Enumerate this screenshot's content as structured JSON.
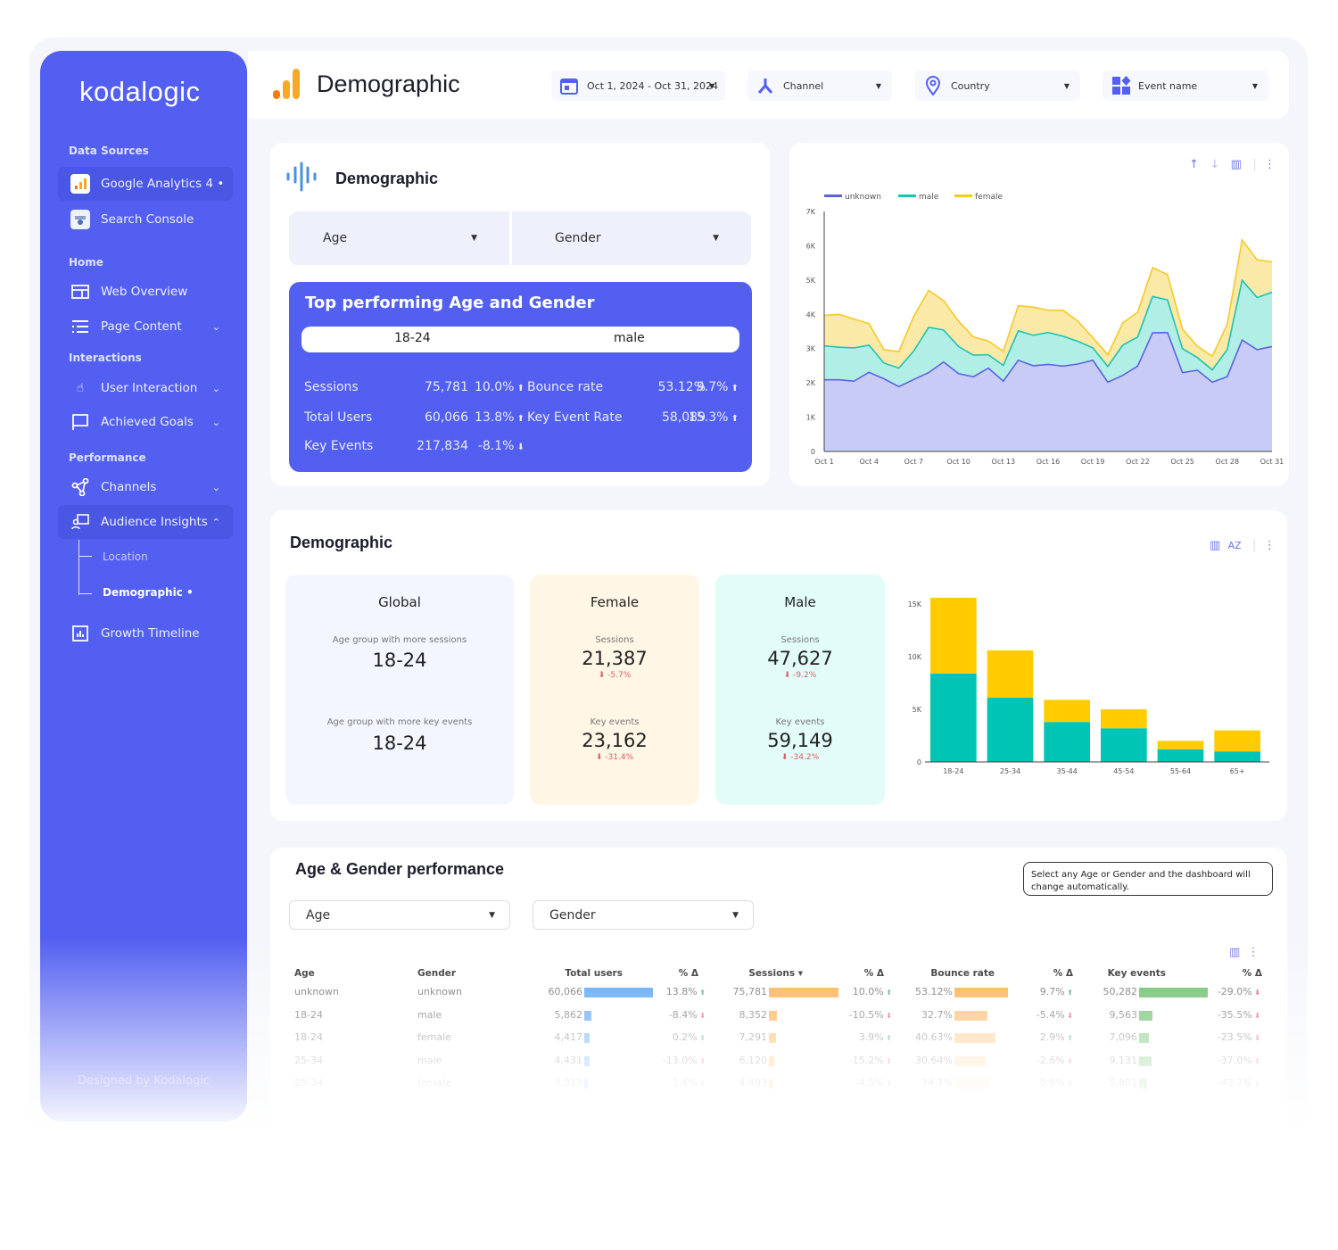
{
  "sidebar": {
    "logo": "kodalogic",
    "sections": {
      "data_sources": "Data Sources",
      "home": "Home",
      "interactions": "Interactions",
      "performance": "Performance"
    },
    "items": [
      {
        "label": "Google Analytics 4 •",
        "icon": "google-analytics-icon"
      },
      {
        "label": "Search Console",
        "icon": "search-console-icon"
      },
      {
        "label": "Web Overview",
        "icon": "web-overview-icon"
      },
      {
        "label": "Page Content",
        "icon": "list-icon"
      },
      {
        "label": "User Interaction",
        "icon": "hand-pointer-icon"
      },
      {
        "label": "Achieved Goals",
        "icon": "flag-icon"
      },
      {
        "label": "Channels",
        "icon": "share-nodes-icon"
      },
      {
        "label": "Audience Insights",
        "icon": "audience-icon"
      },
      {
        "label": "Growth Timeline",
        "icon": "bar-chart-icon"
      }
    ],
    "subitems": [
      {
        "label": "Location"
      },
      {
        "label": "Demographic •"
      }
    ],
    "footer": "Designed by Kodalogic"
  },
  "header": {
    "title": "Demographic",
    "filters": [
      {
        "label": "Oct 1, 2024 - Oct 31, 2024",
        "icon": "calendar-icon"
      },
      {
        "label": "Channel",
        "icon": "channel-icon"
      },
      {
        "label": "Country",
        "icon": "location-pin-icon"
      },
      {
        "label": "Event name",
        "icon": "shapes-icon"
      }
    ]
  },
  "colors": {
    "accent": "#525ff0",
    "unknown": "#5b62e0",
    "male": "#1fc2b0",
    "female": "#f5c928",
    "bar_male": "#00c4b4",
    "bar_female": "#ffcc00"
  },
  "top_card": {
    "title": "Demographic",
    "age_select": "Age",
    "gender_select": "Gender",
    "top": {
      "title": "Top performing Age and Gender",
      "age": "18-24",
      "gender": "male",
      "metrics": [
        {
          "label": "Sessions",
          "value": "75,781",
          "delta": "10.0%",
          "dir": "up"
        },
        {
          "label": "Bounce rate",
          "value": "53.12%",
          "delta": "9.7%",
          "dir": "up"
        },
        {
          "label": "Total Users",
          "value": "60,066",
          "delta": "13.8%",
          "dir": "up"
        },
        {
          "label": "Key Event Rate",
          "value": "58,089",
          "delta": "15.3%",
          "dir": "up"
        },
        {
          "label": "Key Events",
          "value": "217,834",
          "delta": "-8.1%",
          "dir": "down"
        }
      ]
    }
  },
  "demo": {
    "title": "Demographic",
    "global": {
      "title": "Global",
      "l1": "Age group with more sessions",
      "v1": "18-24",
      "l2": "Age group with more key events",
      "v2": "18-24"
    },
    "female": {
      "title": "Female",
      "l1": "Sessions",
      "v1": "21,387",
      "d1": "-5.7%",
      "l2": "Key events",
      "v2": "23,162",
      "d2": "-31.4%"
    },
    "male": {
      "title": "Male",
      "l1": "Sessions",
      "v1": "47,627",
      "d1": "-9.2%",
      "l2": "Key events",
      "v2": "59,149",
      "d2": "-34.2%"
    }
  },
  "table": {
    "title": "Age & Gender performance",
    "age_select": "Age",
    "gender_select": "Gender",
    "note": "Select any Age or Gender and the dashboard will change automatically.",
    "headers": [
      "Age",
      "Gender",
      "Total users",
      "% Δ",
      "Sessions ▾",
      "% Δ",
      "Bounce rate",
      "% Δ",
      "Key events",
      "% Δ"
    ],
    "rows": [
      {
        "age": "unknown",
        "gender": "unknown",
        "users": "60,066",
        "users_n": 60066,
        "ud": "13.8%",
        "udir": "up",
        "sessions": "75,781",
        "sessions_n": 75781,
        "sd": "10.0%",
        "sdir": "up",
        "bounce": "53.12%",
        "bounce_n": 53.12,
        "bd": "9.7%",
        "bdir": "up",
        "key": "50,282",
        "key_n": 50282,
        "kd": "-29.0%",
        "kdir": "down"
      },
      {
        "age": "18-24",
        "gender": "male",
        "users": "5,862",
        "users_n": 5862,
        "ud": "-8.4%",
        "udir": "down",
        "sessions": "8,352",
        "sessions_n": 8352,
        "sd": "-10.5%",
        "sdir": "down",
        "bounce": "32.7%",
        "bounce_n": 32.7,
        "bd": "-5.4%",
        "bdir": "down",
        "key": "9,563",
        "key_n": 9563,
        "kd": "-35.5%",
        "kdir": "down"
      },
      {
        "age": "18-24",
        "gender": "female",
        "users": "4,417",
        "users_n": 4417,
        "ud": "0.2%",
        "udir": "up",
        "sessions": "7,291",
        "sessions_n": 7291,
        "sd": "3.9%",
        "sdir": "up",
        "bounce": "40.63%",
        "bounce_n": 40.63,
        "bd": "2.9%",
        "bdir": "up",
        "key": "7,096",
        "key_n": 7096,
        "kd": "-23.5%",
        "kdir": "down"
      },
      {
        "age": "25-34",
        "gender": "male",
        "users": "4,431",
        "users_n": 4431,
        "ud": "-13.0%",
        "udir": "down",
        "sessions": "6,120",
        "sessions_n": 6120,
        "sd": "-15.2%",
        "sdir": "down",
        "bounce": "30.64%",
        "bounce_n": 30.64,
        "bd": "-2.6%",
        "bdir": "down",
        "key": "9,131",
        "key_n": 9131,
        "kd": "-37.0%",
        "kdir": "down"
      },
      {
        "age": "25-34",
        "gender": "female",
        "users": "3,013",
        "users_n": 3013,
        "ud": "1.4%",
        "udir": "up",
        "sessions": "4,493",
        "sessions_n": 4493,
        "sd": "-4.5%",
        "sdir": "down",
        "bounce": "34.7%",
        "bounce_n": 34.7,
        "bd": "5.9%",
        "bdir": "up",
        "key": "5,801",
        "key_n": 5801,
        "kd": "-43.7%",
        "kdir": "down"
      }
    ]
  },
  "chart_data": [
    {
      "type": "area",
      "stacked": true,
      "legend_position": "top-left",
      "grid": false,
      "x": [
        "Oct 1",
        "Oct 2",
        "Oct 3",
        "Oct 4",
        "Oct 5",
        "Oct 6",
        "Oct 7",
        "Oct 8",
        "Oct 9",
        "Oct 10",
        "Oct 11",
        "Oct 12",
        "Oct 13",
        "Oct 14",
        "Oct 15",
        "Oct 16",
        "Oct 17",
        "Oct 18",
        "Oct 19",
        "Oct 20",
        "Oct 21",
        "Oct 22",
        "Oct 23",
        "Oct 24",
        "Oct 25",
        "Oct 26",
        "Oct 27",
        "Oct 28",
        "Oct 29",
        "Oct 30",
        "Oct 31"
      ],
      "x_ticks": [
        "Oct 1",
        "Oct 4",
        "Oct 7",
        "Oct 10",
        "Oct 13",
        "Oct 16",
        "Oct 19",
        "Oct 22",
        "Oct 25",
        "Oct 28",
        "Oct 31"
      ],
      "y_ticks": [
        "0",
        "1K",
        "2K",
        "3K",
        "4K",
        "5K",
        "6K",
        "7K"
      ],
      "ylim": [
        0,
        7000
      ],
      "series": [
        {
          "name": "unknown",
          "values": [
            2090,
            2090,
            2050,
            2310,
            2120,
            1890,
            2100,
            2300,
            2610,
            2270,
            2180,
            2430,
            2050,
            2660,
            2500,
            2540,
            2490,
            2550,
            2660,
            2020,
            2220,
            2490,
            3460,
            3470,
            2300,
            2370,
            2020,
            2180,
            3250,
            2970,
            3060
          ]
        },
        {
          "name": "male",
          "values": [
            990,
            950,
            970,
            790,
            460,
            540,
            830,
            1320,
            930,
            790,
            630,
            390,
            460,
            860,
            890,
            930,
            870,
            660,
            360,
            460,
            880,
            850,
            1060,
            950,
            700,
            370,
            360,
            790,
            1740,
            1520,
            1580
          ]
        },
        {
          "name": "female",
          "values": [
            890,
            960,
            840,
            630,
            390,
            480,
            1010,
            1080,
            860,
            740,
            530,
            400,
            410,
            730,
            820,
            650,
            760,
            590,
            300,
            340,
            650,
            720,
            840,
            740,
            570,
            330,
            400,
            740,
            1180,
            1100,
            890
          ]
        }
      ]
    },
    {
      "type": "bar",
      "stacked": true,
      "grid": false,
      "categories": [
        "18-24",
        "25-34",
        "35-44",
        "45-54",
        "55-64",
        "65+"
      ],
      "y_ticks": [
        "0",
        "5K",
        "10K",
        "15K",
        "20K"
      ],
      "ylim": [
        0,
        20000
      ],
      "series": [
        {
          "values": [
            8400,
            6100,
            3800,
            3200,
            1200,
            1000
          ]
        },
        {
          "values": [
            7200,
            4500,
            2100,
            1800,
            800,
            2000
          ]
        }
      ]
    }
  ]
}
